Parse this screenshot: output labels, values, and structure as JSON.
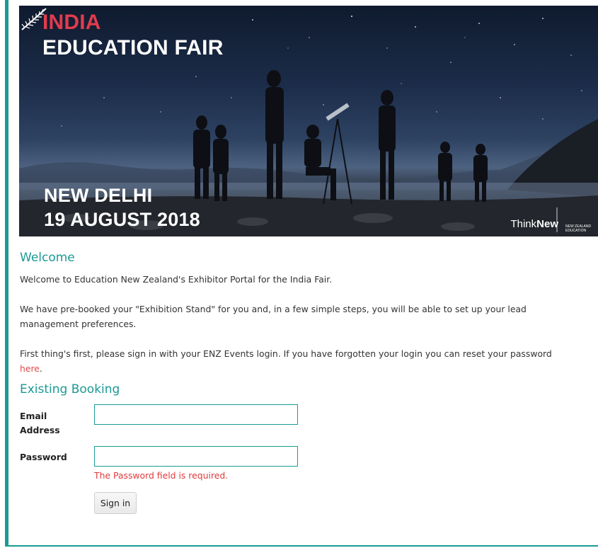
{
  "banner": {
    "line1": "INDIA",
    "line2": "EDUCATION FAIR",
    "city": "NEW DELHI",
    "date": "19 AUGUST 2018",
    "logo_part1": "Think",
    "logo_part2": "New",
    "fern_text": "NEW ZEALAND EDUCATION"
  },
  "welcome": {
    "heading": "Welcome",
    "para1": "Welcome to Education New Zealand's Exhibitor Portal for the India Fair.",
    "para2": "We have pre-booked your \"Exhibition Stand\" for you and, in a few simple steps, you will be able to set up your lead management preferences.",
    "para3_prefix": "First thing's first, please sign in with your ENZ Events login. If you have forgotten your login you can reset your password ",
    "para3_link": "here",
    "para3_suffix": "."
  },
  "booking": {
    "heading": "Existing Booking",
    "email_label": "Email Address",
    "email_value": "",
    "password_label": "Password",
    "password_value": "",
    "password_error": "The Password field is required.",
    "signin_label": "Sign in"
  },
  "colors": {
    "accent": "#1a9a94",
    "error": "#e03a3a",
    "link": "#e24b4b",
    "brand_red": "#e23b4c"
  }
}
